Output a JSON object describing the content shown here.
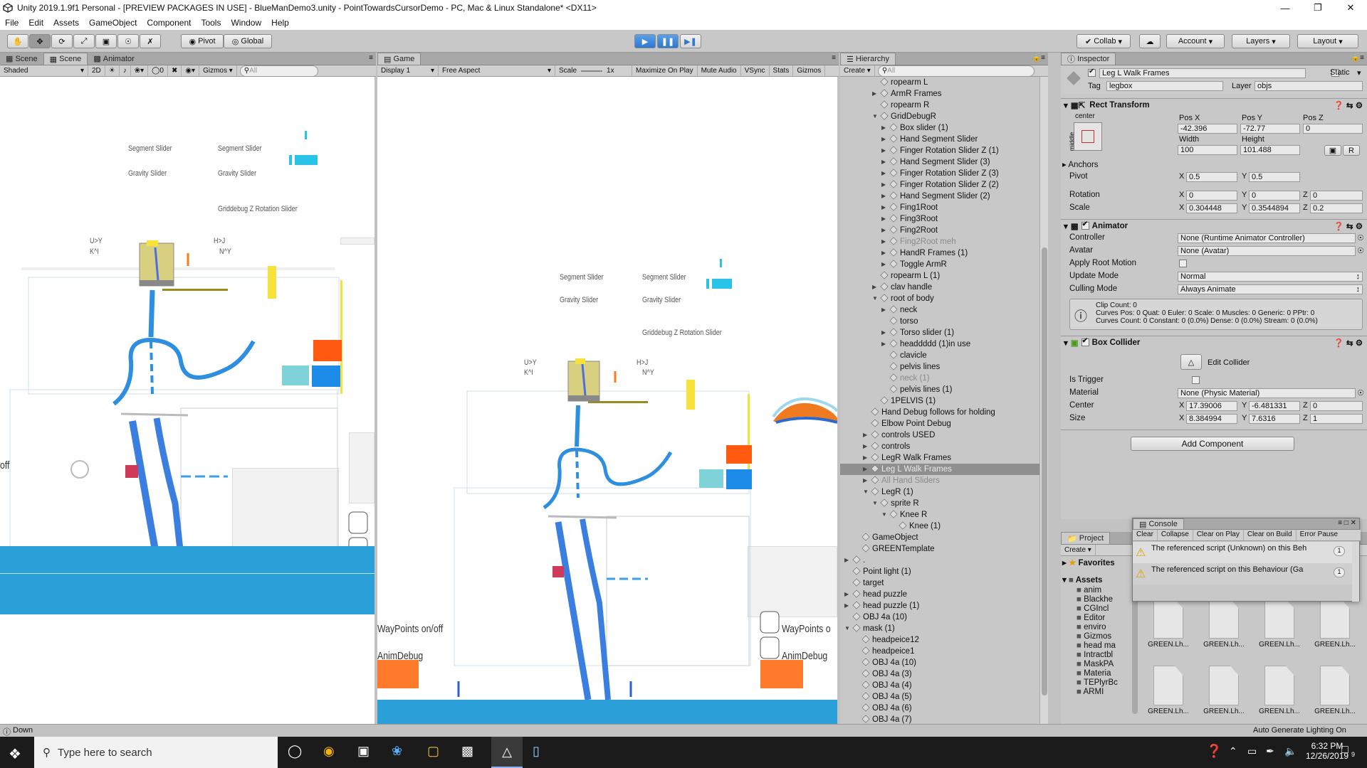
{
  "title": "Unity 2019.1.9f1 Personal - [PREVIEW PACKAGES IN USE] - BlueManDemo3.unity - PointTowardsCursorDemo - PC, Mac & Linux Standalone* <DX11>",
  "menu": [
    "File",
    "Edit",
    "Assets",
    "GameObject",
    "Component",
    "Tools",
    "Window",
    "Help"
  ],
  "toolbar": {
    "pivot": "Pivot",
    "global": "Global",
    "collab": "Collab",
    "account": "Account",
    "layers": "Layers",
    "layout": "Layout"
  },
  "scene": {
    "tabs": [
      "Scene",
      "Scene",
      "Animator"
    ],
    "shaded": "Shaded",
    "mode2d": "2D",
    "zero": "0",
    "gizmos": "Gizmos",
    "search": "All",
    "labels": {
      "seg1": "Segment Slider",
      "seg2": "Segment Slider",
      "grav1": "Gravity Slider",
      "grav2": "Gravity Slider",
      "gridz": "Griddebug Z Rotation Slider",
      "ul1": "U>Y",
      "ul2": "K^I",
      "ur1": "H>J",
      "ur2": "N^Y",
      "waypoints": "WayPoints on/off",
      "animdebug": "AnimDebug",
      "off": "off"
    }
  },
  "game": {
    "tab": "Game",
    "display": "Display 1",
    "aspect": "Free Aspect",
    "scale": "Scale",
    "scaleval": "1x",
    "maximize": "Maximize On Play",
    "mute": "Mute Audio",
    "vsync": "VSync",
    "stats": "Stats",
    "gizmos": "Gizmos",
    "labels": {
      "seg1": "Segment Slider",
      "seg2": "Segment Slider",
      "grav1": "Gravity Slider",
      "grav2": "Gravity Slider",
      "gridz": "Griddebug Z Rotation Slider",
      "ul1": "U>Y",
      "ul2": "K^I",
      "ur1": "H>J",
      "ur2": "N^Y",
      "waypoints": "WayPoints o",
      "animdebug": "AnimDebug"
    }
  },
  "hierarchy": {
    "tab": "Hierarchy",
    "create": "Create",
    "search": "All",
    "items": [
      {
        "t": "ropearm L",
        "d": 3,
        "a": ""
      },
      {
        "t": "ArmR Frames",
        "d": 3,
        "a": "r"
      },
      {
        "t": "ropearm R",
        "d": 3,
        "a": ""
      },
      {
        "t": "GridDebugR",
        "d": 3,
        "a": "d"
      },
      {
        "t": "Box slider (1)",
        "d": 4,
        "a": "r"
      },
      {
        "t": "Hand Segment Slider",
        "d": 4,
        "a": "r"
      },
      {
        "t": "Finger Rotation Slider Z (1)",
        "d": 4,
        "a": "r"
      },
      {
        "t": "Hand Segment Slider (3)",
        "d": 4,
        "a": "r"
      },
      {
        "t": "Finger Rotation Slider Z (3)",
        "d": 4,
        "a": "r"
      },
      {
        "t": "Finger Rotation Slider Z (2)",
        "d": 4,
        "a": "r"
      },
      {
        "t": "Hand Segment Slider (2)",
        "d": 4,
        "a": "r"
      },
      {
        "t": "Fing1Root",
        "d": 4,
        "a": "r"
      },
      {
        "t": "Fing3Root",
        "d": 4,
        "a": "r"
      },
      {
        "t": "Fing2Root",
        "d": 4,
        "a": "r"
      },
      {
        "t": "Fing2Root meh",
        "d": 4,
        "a": "r",
        "dim": true
      },
      {
        "t": "HandR Frames (1)",
        "d": 4,
        "a": "r"
      },
      {
        "t": "Toggle ArmR",
        "d": 4,
        "a": "r"
      },
      {
        "t": "ropearm L (1)",
        "d": 3,
        "a": ""
      },
      {
        "t": "clav handle",
        "d": 3,
        "a": "r"
      },
      {
        "t": "root of body",
        "d": 3,
        "a": "d"
      },
      {
        "t": "neck",
        "d": 4,
        "a": "r"
      },
      {
        "t": "torso",
        "d": 4,
        "a": ""
      },
      {
        "t": "Torso slider (1)",
        "d": 4,
        "a": "r"
      },
      {
        "t": "headdddd (1)in use",
        "d": 4,
        "a": "r"
      },
      {
        "t": "clavicle",
        "d": 4,
        "a": ""
      },
      {
        "t": "pelvis lines",
        "d": 4,
        "a": ""
      },
      {
        "t": "neck (1)",
        "d": 4,
        "a": "",
        "dim": true
      },
      {
        "t": "pelvis lines (1)",
        "d": 4,
        "a": ""
      },
      {
        "t": "1PELVIS (1)",
        "d": 3,
        "a": ""
      },
      {
        "t": "Hand Debug follows for holding",
        "d": 2,
        "a": ""
      },
      {
        "t": "Elbow Point Debug",
        "d": 2,
        "a": ""
      },
      {
        "t": "controls USED",
        "d": 2,
        "a": "r"
      },
      {
        "t": "controls",
        "d": 2,
        "a": "r"
      },
      {
        "t": "LegR Walk Frames",
        "d": 2,
        "a": "r"
      },
      {
        "t": "Leg L Walk Frames",
        "d": 2,
        "a": "r",
        "sel": true
      },
      {
        "t": "All Hand Sliders",
        "d": 2,
        "a": "r",
        "dim": true
      },
      {
        "t": "LegR (1)",
        "d": 2,
        "a": "d"
      },
      {
        "t": "sprite R",
        "d": 3,
        "a": "d"
      },
      {
        "t": "Knee R",
        "d": 4,
        "a": "d"
      },
      {
        "t": "Knee (1)",
        "d": 5,
        "a": ""
      },
      {
        "t": "GameObject",
        "d": 1,
        "a": ""
      },
      {
        "t": "GREENTemplate",
        "d": 1,
        "a": ""
      },
      {
        "t": ".",
        "d": 0,
        "a": "r"
      },
      {
        "t": "Point light (1)",
        "d": 0,
        "a": ""
      },
      {
        "t": "target",
        "d": 0,
        "a": ""
      },
      {
        "t": "head puzzle",
        "d": 0,
        "a": "r"
      },
      {
        "t": "head puzzle (1)",
        "d": 0,
        "a": "r"
      },
      {
        "t": "OBJ 4a (10)",
        "d": 0,
        "a": ""
      },
      {
        "t": "mask (1)",
        "d": 0,
        "a": "d"
      },
      {
        "t": "headpeice12",
        "d": 1,
        "a": ""
      },
      {
        "t": "headpeice1",
        "d": 1,
        "a": ""
      },
      {
        "t": "OBJ 4a (10)",
        "d": 1,
        "a": ""
      },
      {
        "t": "OBJ 4a (3)",
        "d": 1,
        "a": ""
      },
      {
        "t": "OBJ 4a (4)",
        "d": 1,
        "a": ""
      },
      {
        "t": "OBJ 4a (5)",
        "d": 1,
        "a": ""
      },
      {
        "t": "OBJ 4a (6)",
        "d": 1,
        "a": ""
      },
      {
        "t": "OBJ 4a (7)",
        "d": 1,
        "a": ""
      }
    ]
  },
  "inspector": {
    "tab": "Inspector",
    "name": "Leg L Walk Frames",
    "static": "Static",
    "tag_lbl": "Tag",
    "tag": "legbox",
    "layer_lbl": "Layer",
    "layer": "objs",
    "rect": {
      "title": "Rect Transform",
      "center": "center",
      "middle": "middle",
      "posx_l": "Pos X",
      "posy_l": "Pos Y",
      "posz_l": "Pos Z",
      "posx": "-42.396",
      "posy": "-72.77",
      "posz": "0",
      "width_l": "Width",
      "height_l": "Height",
      "width": "100",
      "height": "101.488",
      "anchors": "Anchors",
      "pivot": "Pivot",
      "pivx": "0.5",
      "pivy": "0.5",
      "rotation": "Rotation",
      "rotx": "0",
      "roty": "0",
      "rotz": "0",
      "scale": "Scale",
      "sclx": "0.304448",
      "scly": "0.3544894",
      "sclz": "0.2",
      "r": "R"
    },
    "animator": {
      "title": "Animator",
      "controller_l": "Controller",
      "controller": "None (Runtime Animator Controller)",
      "avatar_l": "Avatar",
      "avatar": "None (Avatar)",
      "root_l": "Apply Root Motion",
      "update_l": "Update Mode",
      "update": "Normal",
      "culling_l": "Culling Mode",
      "culling": "Always Animate",
      "info1": "Clip Count: 0",
      "info2": "Curves Pos: 0 Quat: 0 Euler: 0 Scale: 0 Muscles: 0 Generic: 0 PPtr: 0",
      "info3": "Curves Count: 0 Constant: 0 (0.0%) Dense: 0 (0.0%) Stream: 0 (0.0%)"
    },
    "box": {
      "title": "Box Collider",
      "edit": "Edit Collider",
      "trigger_l": "Is Trigger",
      "material_l": "Material",
      "material": "None (Physic Material)",
      "center_l": "Center",
      "cx": "17.39006",
      "cy": "-6.481331",
      "cz": "0",
      "size_l": "Size",
      "sx": "8.384994",
      "sy": "7.6316",
      "sz": "1"
    },
    "add": "Add Component",
    "x": "X",
    "y": "Y",
    "z": "Z"
  },
  "project": {
    "tab": "Project",
    "create": "Create",
    "favorites": "Favorites",
    "assets": "Assets",
    "folders": [
      "anim",
      "Blackhe",
      "CGIncl",
      "Editor",
      "enviro",
      "Gizmos",
      "head ma",
      "Intractbl",
      "MaskPA",
      "Materia",
      "TEPlyrBc",
      "ARMI"
    ],
    "files": [
      "GREEN.Lh...",
      "GREEN.Lh...",
      "GREEN.Lh...",
      "GREEN.Lh...",
      "GREEN.Lh...",
      "GREEN.Lh...",
      "GREEN.Lh...",
      "GREEN.Lh..."
    ]
  },
  "console": {
    "tab": "Console",
    "clear": "Clear",
    "collapse": "Collapse",
    "clearplay": "Clear on Play",
    "clearbuild": "Clear on Build",
    "errorpause": "Error Pause",
    "msg1": "The referenced script (Unknown) on this Beh",
    "msg2": "The referenced script on this Behaviour (Ga",
    "count1": "1",
    "count2": "1"
  },
  "status": {
    "left": "Down",
    "right": "Auto Generate Lighting On"
  },
  "taskbar": {
    "search": "Type here to search",
    "time": "6:32 PM",
    "date": "12/26/2019",
    "notif": "9"
  },
  "colors": {
    "blue": "#3b9ee8",
    "limb": "#2e8fe0",
    "orange": "#ff6a13",
    "floor": "#2a9fd8",
    "selected": "#8f8f8f"
  }
}
